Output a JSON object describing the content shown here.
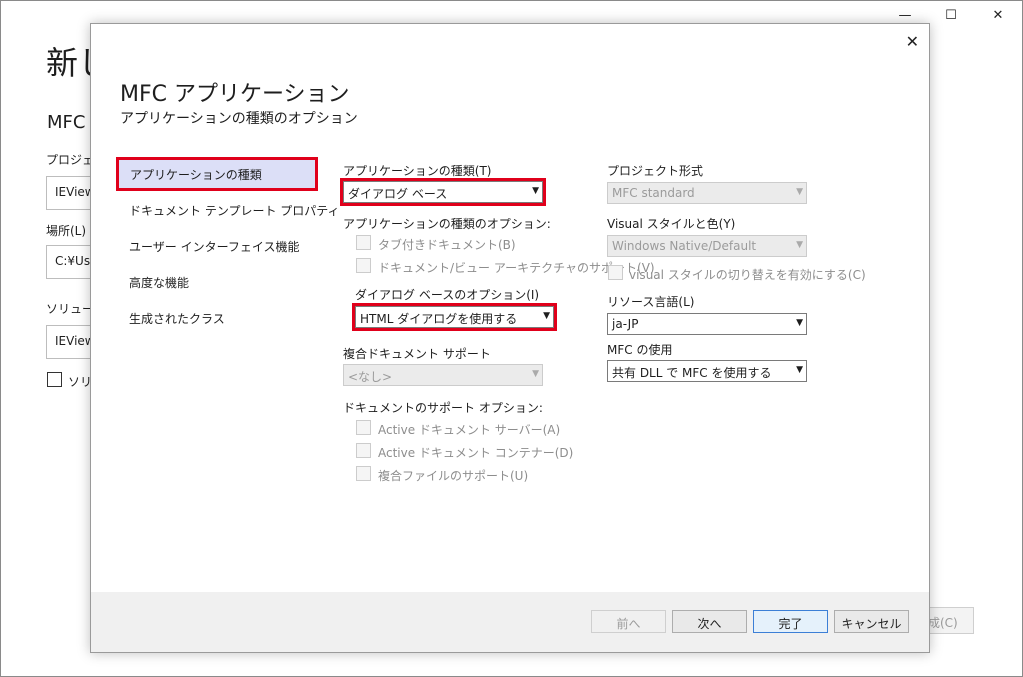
{
  "background_window": {
    "title": "新し",
    "subtitle": "MFC ア",
    "project_label": "プロジェク",
    "project_value": "IEView",
    "location_label": "場所(L)",
    "location_value": "C:¥Use",
    "solution_label": "ソリューシ",
    "solution_value": "IEView",
    "checkbox_label": "ソリュ",
    "create_button": "成(C)",
    "controls": {
      "minimize": "—",
      "maximize": "☐",
      "close": "✕"
    }
  },
  "dialog": {
    "close": "✕",
    "title": "MFC アプリケーション",
    "subtitle": "アプリケーションの種類のオプション",
    "nav": [
      {
        "label": "アプリケーションの種類"
      },
      {
        "label": "ドキュメント テンプレート プロパティ"
      },
      {
        "label": "ユーザー インターフェイス機能"
      },
      {
        "label": "高度な機能"
      },
      {
        "label": "生成されたクラス"
      }
    ],
    "app_type": {
      "label": "アプリケーションの種類(T)",
      "value": "ダイアログ ベース"
    },
    "app_type_options": {
      "label": "アプリケーションの種類のオプション:",
      "tabbed_docs": "タブ付きドキュメント(B)",
      "doc_view": "ドキュメント/ビュー アーキテクチャのサポート(V)"
    },
    "dialog_options": {
      "label": "ダイアログ ベースのオプション(I)",
      "value": "HTML ダイアログを使用する"
    },
    "compound_doc": {
      "label": "複合ドキュメント サポート",
      "value": "<なし>"
    },
    "doc_support": {
      "label": "ドキュメントのサポート オプション:",
      "active_server": "Active ドキュメント サーバー(A)",
      "active_container": "Active ドキュメント コンテナー(D)",
      "compound_file": "複合ファイルのサポート(U)"
    },
    "project_style": {
      "label": "プロジェクト形式",
      "value": "MFC standard"
    },
    "visual_style": {
      "label": "Visual スタイルと色(Y)",
      "value": "Windows Native/Default"
    },
    "visual_toggle": "visual スタイルの切り替えを有効にする(C)",
    "resource_lang": {
      "label": "リソース言語(L)",
      "value": "ja-JP"
    },
    "mfc_use": {
      "label": "MFC の使用",
      "value": "共有 DLL で MFC を使用する"
    },
    "buttons": {
      "prev": "前へ",
      "next": "次へ",
      "finish": "完了",
      "cancel": "キャンセル"
    }
  },
  "colors": {
    "highlight": "#e0001b",
    "nav_active_bg": "#dcdff7",
    "footer_bg": "#f0f0f0"
  }
}
